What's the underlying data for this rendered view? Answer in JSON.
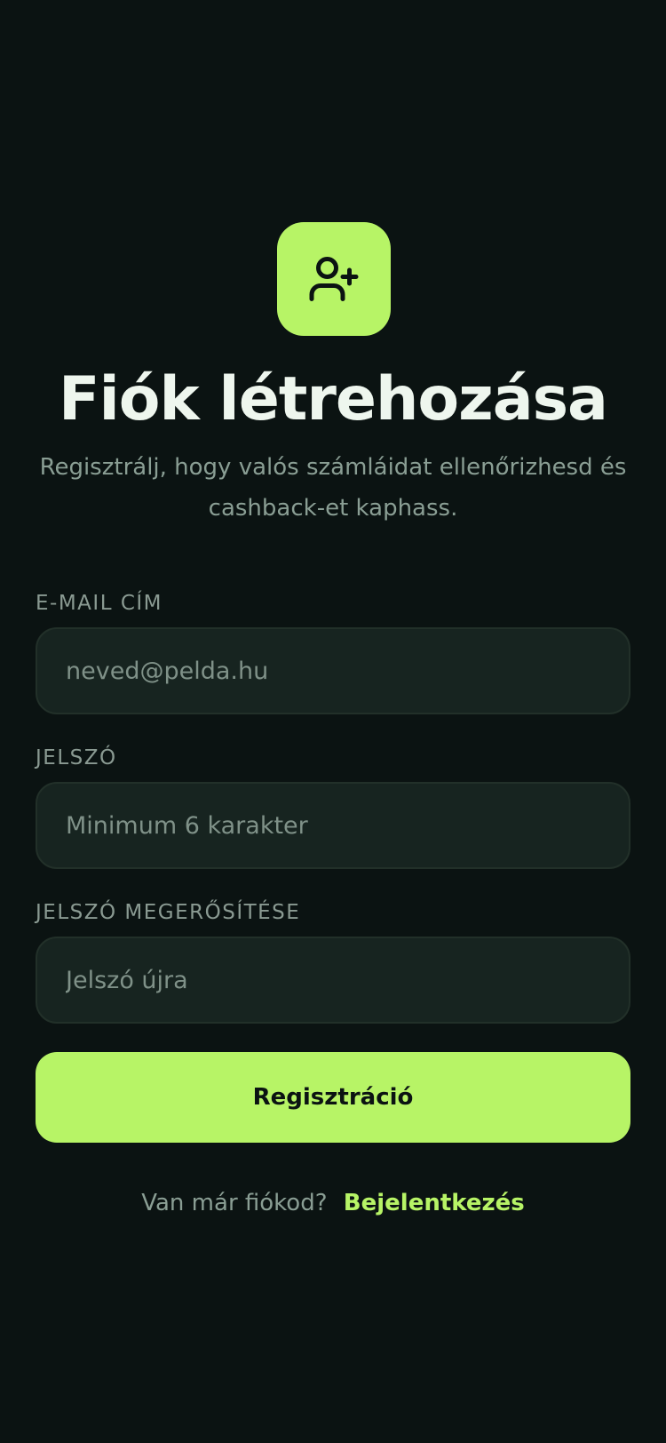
{
  "colors": {
    "background": "#0b1312",
    "accent": "#b7f466",
    "input_background": "#172420",
    "input_border": "#223029",
    "heading_text": "#eef6ee",
    "muted_text": "#8a9e94"
  },
  "header": {
    "icon": "user-plus-icon",
    "title": "Fiók létrehozása",
    "subtitle": "Regisztrálj, hogy valós számláidat ellenőrizhesd és cashback-et kaphass."
  },
  "form": {
    "email": {
      "label": "E-MAIL CÍM",
      "placeholder": "neved@pelda.hu",
      "value": ""
    },
    "password": {
      "label": "JELSZÓ",
      "placeholder": "Minimum 6 karakter",
      "value": ""
    },
    "password_confirm": {
      "label": "JELSZÓ MEGERŐSÍTÉSE",
      "placeholder": "Jelszó újra",
      "value": ""
    },
    "submit_label": "Regisztráció"
  },
  "footer": {
    "prompt": "Van már fiókod?",
    "login_link": "Bejelentkezés"
  }
}
